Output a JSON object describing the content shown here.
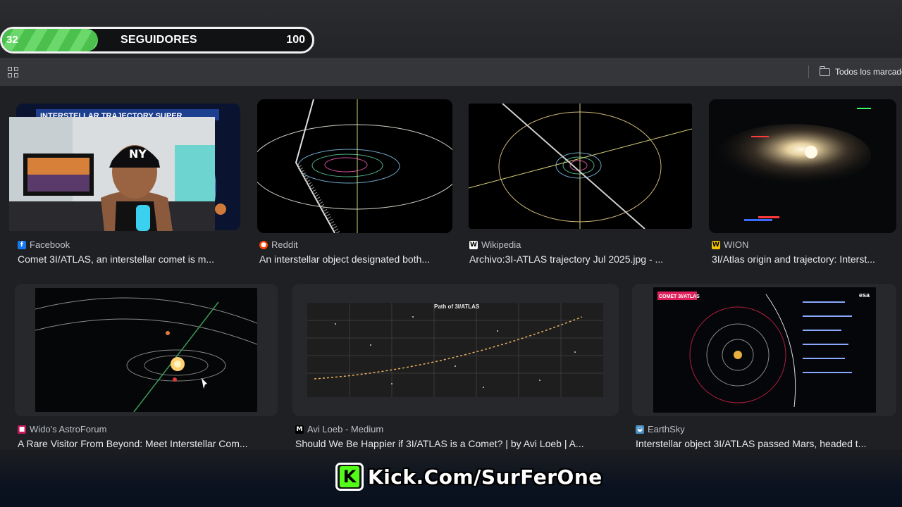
{
  "followers_widget": {
    "count": "32",
    "label": "SEGUIDORES",
    "goal": "100",
    "progress_fraction": 0.32
  },
  "bookmarks_bar": {
    "all_bookmarks_label": "Todos los marcado"
  },
  "results": [
    {
      "source": "Facebook",
      "title": "Comet 3I/ATLAS, an interstellar comet is m...",
      "favicon_color": "#1877f2",
      "favicon_glyph": "f",
      "thumb_text": "INTERSTELLAR TRAJECTORY SUPER"
    },
    {
      "source": "Reddit",
      "title": "An interstellar object designated both...",
      "favicon_color": "#ff4500",
      "favicon_glyph": "●"
    },
    {
      "source": "Wikipedia",
      "title": "Archivo:3I-ATLAS trajectory Jul 2025.jpg - ...",
      "favicon_color": "#ffffff",
      "favicon_glyph": "W"
    },
    {
      "source": "WION",
      "title": "3I/Atlas origin and trajectory: Interst...",
      "favicon_color": "#f2c200",
      "favicon_glyph": "W"
    },
    {
      "source": "Wido's AstroForum",
      "title": "A Rare Visitor From Beyond: Meet Interstellar Com...",
      "favicon_color": "#c2185b",
      "favicon_glyph": "■"
    },
    {
      "source": "Avi Loeb - Medium",
      "title": "Should We Be Happier if 3I/ATLAS is a Comet? | by Avi Loeb | A...",
      "favicon_color": "#000000",
      "favicon_glyph": "M",
      "thumb_text": "Path of 3I/ATLAS"
    },
    {
      "source": "EarthSky",
      "title": "Interstellar object 3I/ATLAS passed Mars, headed t...",
      "favicon_color": "#4a90c2",
      "favicon_glyph": "◒",
      "thumb_text": "COMET 3I/ATLAS",
      "thumb_brand": "esa"
    }
  ],
  "kick_banner": {
    "text": "Kick.Com/SurFerOne",
    "logo_letter": "K",
    "brand_color": "#53fc18"
  },
  "colors": {
    "page_bg": "#1f2023",
    "bookmarks_bg": "#35363a",
    "progress_green": "#4cc04c"
  }
}
